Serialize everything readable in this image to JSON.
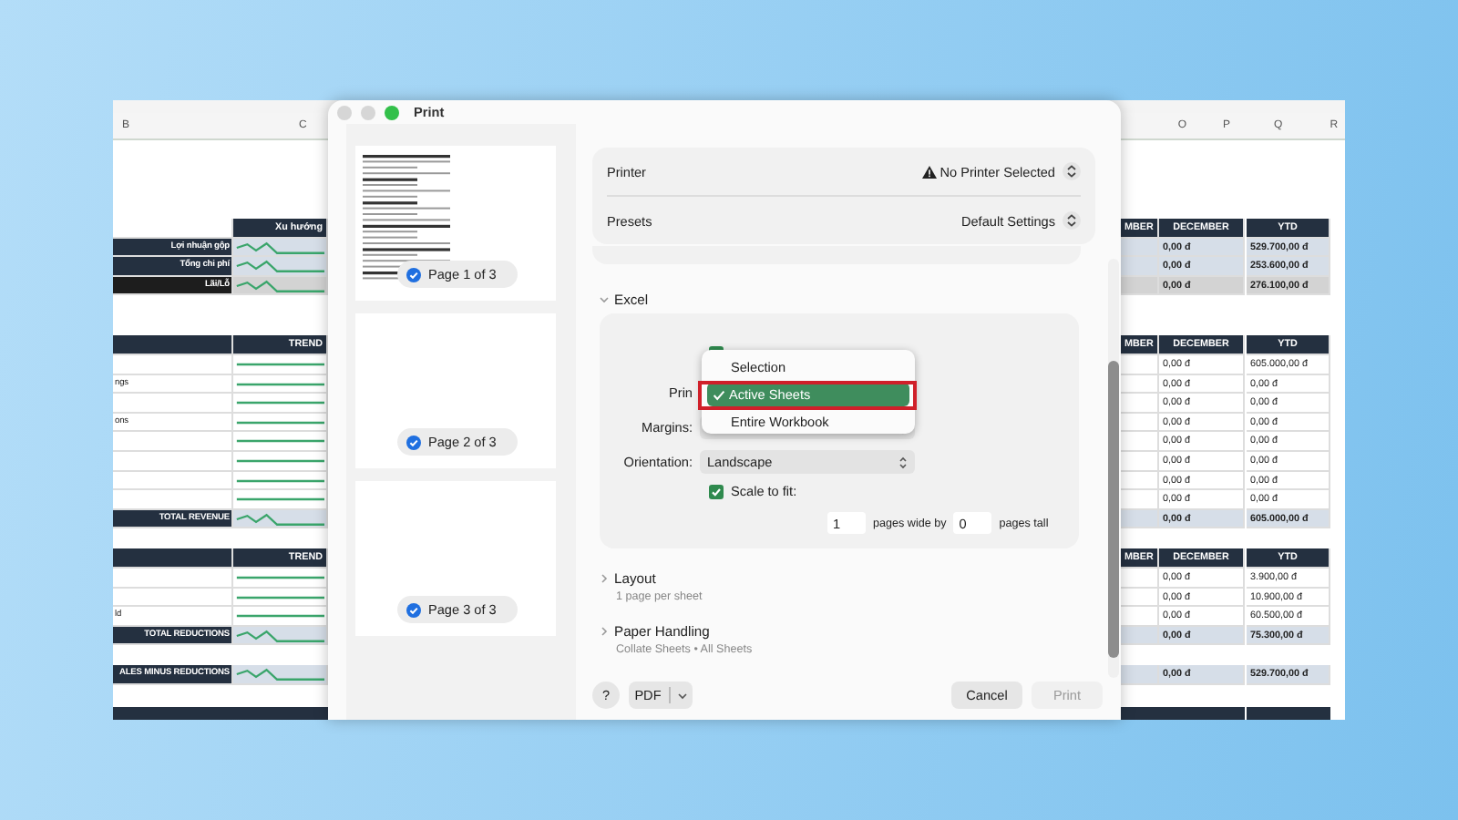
{
  "spreadsheet": {
    "left_columns": [
      "B",
      "C"
    ],
    "right_columns": [
      "O",
      "P",
      "Q",
      "R"
    ],
    "sections": [
      {
        "kind": "summary",
        "header": {
          "trend": "Xu hướng",
          "month": "MBER",
          "december": "DECEMBER",
          "ytd": "YTD"
        },
        "rows": [
          {
            "kind": "total",
            "label": "Lợi nhuận gộp",
            "december": "0,00 đ",
            "ytd": "529.700,00 đ"
          },
          {
            "kind": "total",
            "label": "Tổng chi phí",
            "december": "0,00 đ",
            "ytd": "253.600,00 đ"
          },
          {
            "kind": "result",
            "label": "Lãi/Lỗ",
            "december": "0,00 đ",
            "ytd": "276.100,00 đ"
          }
        ]
      },
      {
        "kind": "detail",
        "header": {
          "trend": "TREND",
          "month": "MBER",
          "december": "DECEMBER",
          "ytd": "YTD"
        },
        "rows": [
          {
            "kind": "item",
            "december": "0,00 đ",
            "ytd": "605.000,00 đ"
          },
          {
            "kind": "item",
            "label": "ngs",
            "december": "0,00 đ",
            "ytd": "0,00 đ"
          },
          {
            "kind": "item",
            "december": "0,00 đ",
            "ytd": "0,00 đ"
          },
          {
            "kind": "item",
            "label": "ons",
            "december": "0,00 đ",
            "ytd": "0,00 đ"
          },
          {
            "kind": "item",
            "december": "0,00 đ",
            "ytd": "0,00 đ"
          },
          {
            "kind": "item",
            "december": "0,00 đ",
            "ytd": "0,00 đ"
          },
          {
            "kind": "item",
            "december": "0,00 đ",
            "ytd": "0,00 đ"
          },
          {
            "kind": "item",
            "december": "0,00 đ",
            "ytd": "0,00 đ"
          },
          {
            "kind": "total",
            "label": "TOTAL REVENUE",
            "december": "0,00 đ",
            "ytd": "605.000,00 đ"
          }
        ]
      },
      {
        "kind": "detail",
        "header": {
          "trend": "TREND",
          "month": "MBER",
          "december": "DECEMBER",
          "ytd": "YTD"
        },
        "rows": [
          {
            "kind": "item",
            "december": "0,00 đ",
            "ytd": "3.900,00 đ"
          },
          {
            "kind": "item",
            "december": "0,00 đ",
            "ytd": "10.900,00 đ"
          },
          {
            "kind": "item",
            "label": "ld",
            "december": "0,00 đ",
            "ytd": "60.500,00 đ"
          },
          {
            "kind": "total",
            "label": "TOTAL REDUCTIONS",
            "december": "0,00 đ",
            "ytd": "75.300,00 đ"
          }
        ]
      },
      {
        "kind": "detail",
        "rows": [
          {
            "kind": "total",
            "label": "ALES MINUS REDUCTIONS",
            "december": "0,00 đ",
            "ytd": "529.700,00 đ"
          }
        ]
      }
    ]
  },
  "print_dialog": {
    "title": "Print",
    "pages": [
      {
        "label": "Page 1 of 3",
        "selected": true,
        "kind": "filled"
      },
      {
        "label": "Page 2 of 3",
        "selected": true,
        "kind": "blank"
      },
      {
        "label": "Page 3 of 3",
        "selected": true,
        "kind": "blank"
      }
    ],
    "printer": {
      "label": "Printer",
      "value": "No Printer Selected",
      "warning": true
    },
    "presets": {
      "label": "Presets",
      "value": "Default Settings"
    },
    "excel": {
      "title": "Excel",
      "expanded": true,
      "collate": {
        "checked": true
      },
      "print_label": "Prin",
      "margins_label": "Margins:",
      "orientation_label": "Orientation:",
      "orientation": "Landscape",
      "scale_to_fit": {
        "label": "Scale to fit:",
        "checked": true
      },
      "pages_wide": "1",
      "pages_wide_label": "pages wide by",
      "pages_tall": "0",
      "pages_tall_label": "pages tall"
    },
    "print_menu": {
      "items": [
        {
          "label": "Selection",
          "selected": false
        },
        {
          "label": "Active Sheets",
          "selected": true
        },
        {
          "label": "Entire Workbook",
          "selected": false
        }
      ]
    },
    "panels": [
      {
        "title": "Layout",
        "summary": "1 page per sheet",
        "expanded": false
      },
      {
        "title": "Paper Handling",
        "summary": "Collate Sheets • All Sheets",
        "expanded": false
      }
    ],
    "help_button": "?",
    "pdf_button": "PDF",
    "cancel_button": "Cancel",
    "print_button": {
      "label": "Print",
      "disabled": true
    }
  }
}
